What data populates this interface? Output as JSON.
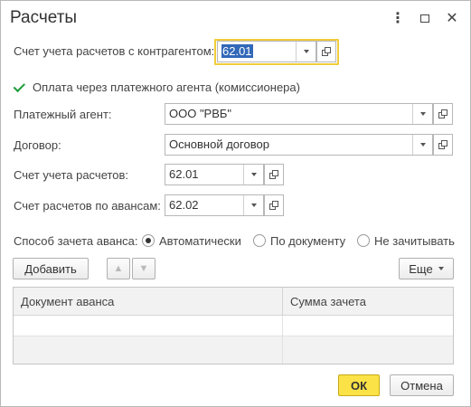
{
  "window": {
    "title": "Расчеты",
    "menu_icon": "more-vertical-icon",
    "maximize_icon": "maximize-icon",
    "close_icon": "close-icon"
  },
  "form": {
    "counterparty_account": {
      "label": "Счет учета расчетов с контрагентом:",
      "value": "62.01"
    },
    "agent_payment": {
      "label": "Оплата через платежного агента (комиссионера)",
      "checked": true
    },
    "payment_agent": {
      "label": "Платежный агент:",
      "value": "ООО \"РВБ\""
    },
    "contract": {
      "label": "Договор:",
      "value": "Основной договор"
    },
    "settlement_account": {
      "label": "Счет учета расчетов:",
      "value": "62.01"
    },
    "advance_account": {
      "label": "Счет расчетов по авансам:",
      "value": "62.02"
    },
    "offset_method": {
      "label": "Способ зачета аванса:",
      "options": [
        "Автоматически",
        "По документу",
        "Не зачитывать"
      ],
      "selected": "Автоматически"
    }
  },
  "toolbar": {
    "add_label": "Добавить",
    "up_icon": "arrow-up-icon",
    "down_icon": "arrow-down-icon",
    "more_label": "Еще"
  },
  "table": {
    "columns": [
      "Документ аванса",
      "Сумма зачета"
    ],
    "rows": [
      [
        "",
        ""
      ],
      [
        "",
        ""
      ]
    ]
  },
  "footer": {
    "ok_label": "ОК",
    "cancel_label": "Отмена"
  },
  "colors": {
    "accent_yellow": "#fbe246",
    "focus_border": "#f1cc3a",
    "check_green": "#1e9c3b",
    "selection_blue": "#3268b8"
  }
}
